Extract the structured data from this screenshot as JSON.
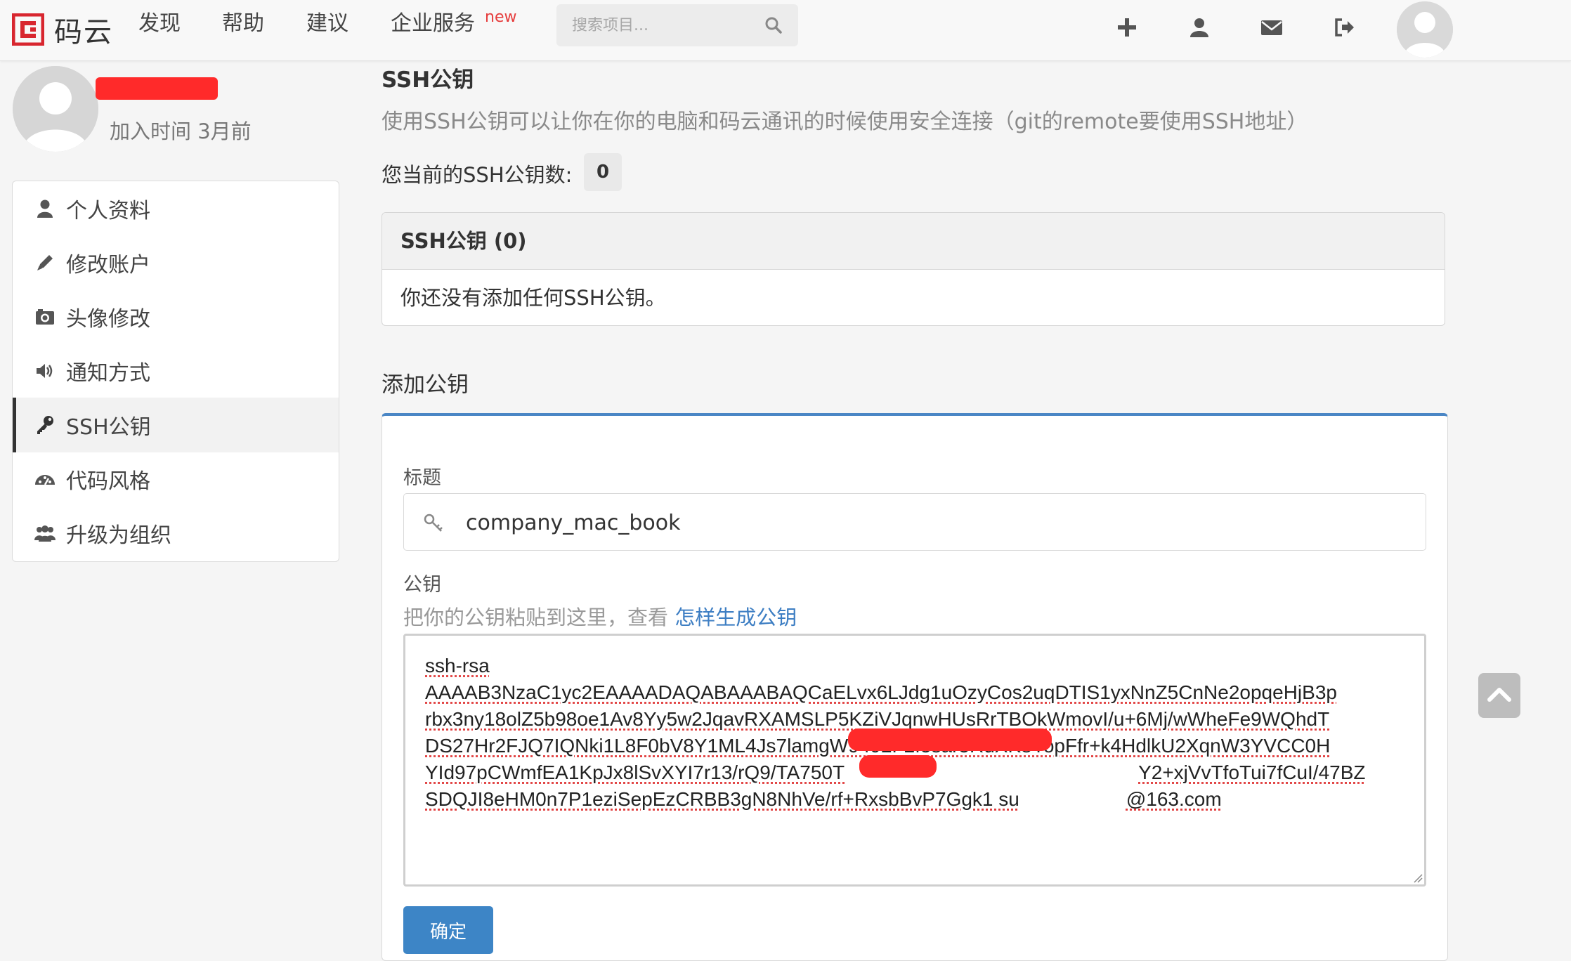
{
  "brand": {
    "name": "码云",
    "color": "#d8262f"
  },
  "nav": {
    "items": [
      {
        "label": "发现"
      },
      {
        "label": "帮助"
      },
      {
        "label": "建议"
      },
      {
        "label": "企业服务"
      }
    ],
    "new_badge": "new",
    "search_placeholder": "搜索项目...",
    "icons": [
      "plus-icon",
      "user-icon",
      "envelope-icon",
      "sign-out-icon"
    ]
  },
  "profile": {
    "join_time": "加入时间 3月前"
  },
  "sidebar": {
    "items": [
      {
        "label": "个人资料",
        "icon": "user-icon"
      },
      {
        "label": "修改账户",
        "icon": "pencil-icon"
      },
      {
        "label": "头像修改",
        "icon": "camera-icon"
      },
      {
        "label": "通知方式",
        "icon": "volume-icon"
      },
      {
        "label": "SSH公钥",
        "icon": "key-icon",
        "active": true
      },
      {
        "label": "代码风格",
        "icon": "dashboard-icon"
      },
      {
        "label": "升级为组织",
        "icon": "group-icon"
      }
    ]
  },
  "main": {
    "title": "SSH公钥",
    "description": "使用SSH公钥可以让你在你的电脑和码云通讯的时候使用安全连接（git的remote要使用SSH地址）",
    "count_label": "您当前的SSH公钥数:",
    "count": "0",
    "panel": {
      "heading": "SSH公钥 (0)",
      "empty_text": "你还没有添加任何SSH公钥。"
    },
    "add": {
      "heading": "添加公钥",
      "title_label": "标题",
      "title_value": "company_mac_book",
      "key_label": "公钥",
      "hint_prefix": "把你的公钥粘贴到这里，查看",
      "hint_link": "怎样生成公钥",
      "key_lines": [
        "ssh-rsa",
        "AAAAB3NzaC1yc2EAAAADAQABAAABAQCaELvx6LJdg1uOzyCos2uqDTIS1yxNnZ5CnNe2opqeHjB3p",
        "rbx3ny18olZ5b98oe1Av8Yy5w2JqavRXAMSLP5KZiVJqnwHUsRrTBOkWmovI/u+6Mj/wWheFe9WQhdT",
        "DS27Hr2FJQ7IQNki1L8F0bV8Y1ML4Js7lamgW9492F2f5sar5RuXK8YopFfr+k4HdlkU2XqnW3YVCC0H",
        "YId97pCWmfEA1KpJx8lSvXYI7r13/rQ9/TA750T",
        "Y2+xjVvTfoTui7fCuI/47BZ",
        "SDQJI8eHM0n7P1eziSepEzCRBB3gN8NhVe/rf+RxsbBvP7Ggk1 su",
        "@163.com"
      ],
      "submit_label": "确定"
    }
  },
  "colors": {
    "accent": "#3d85c6",
    "link": "#3d7ec3",
    "new_badge": "#e63c3c",
    "redaction": "#ff2a2a"
  }
}
